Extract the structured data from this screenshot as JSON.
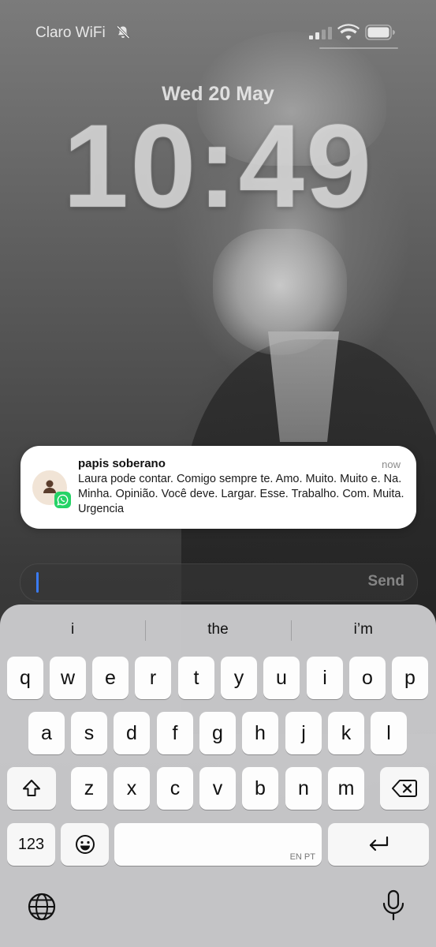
{
  "status_bar": {
    "carrier": "Claro WiFi",
    "mute_icon": "bell-slash-icon",
    "signal_icon": "cellular-signal-icon",
    "wifi_icon": "wifi-icon",
    "battery_icon": "battery-icon"
  },
  "lock_screen": {
    "date": "Wed 20 May",
    "time": "10:49"
  },
  "notification": {
    "app_icon": "whatsapp-icon",
    "sender": "papis soberano",
    "time": "now",
    "message": "Laura pode contar. Comigo sempre  te. Amo. Muito. Muito  e. Na. Minha. Opinião. Você  deve. Largar.  Esse. Trabalho. Com. Muita. Urgencia"
  },
  "reply": {
    "placeholder": "",
    "send_label": "Send"
  },
  "keyboard": {
    "predictions": [
      "i",
      "the",
      "i’m"
    ],
    "row1": [
      "q",
      "w",
      "e",
      "r",
      "t",
      "y",
      "u",
      "i",
      "o",
      "p"
    ],
    "row2": [
      "a",
      "s",
      "d",
      "f",
      "g",
      "h",
      "j",
      "k",
      "l"
    ],
    "row3": [
      "z",
      "x",
      "c",
      "v",
      "b",
      "n",
      "m"
    ],
    "numbers_label": "123",
    "space_hint": "EN PT",
    "shift_icon": "shift-icon",
    "delete_icon": "delete-icon",
    "emoji_icon": "emoji-icon",
    "return_icon": "return-icon",
    "globe_icon": "globe-icon",
    "mic_icon": "microphone-icon"
  }
}
